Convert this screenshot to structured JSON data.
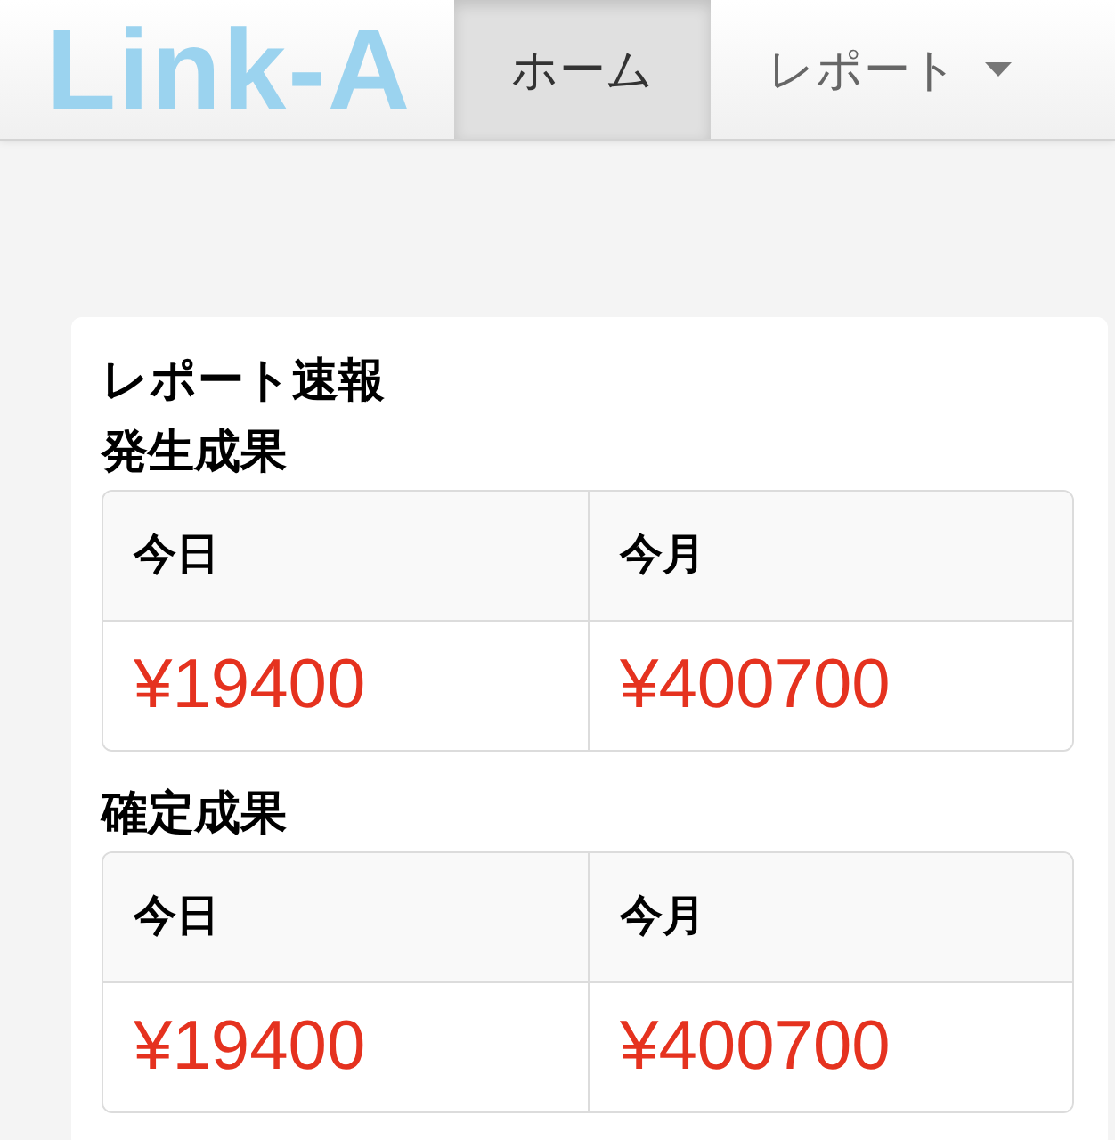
{
  "navbar": {
    "logo": "Link-A",
    "items": [
      {
        "label": "ホーム",
        "kind": "link",
        "selected": true
      },
      {
        "label": "レポート",
        "kind": "dropdown",
        "selected": false
      }
    ]
  },
  "card": {
    "title": "レポート速報",
    "sections": [
      {
        "heading": "発生成果",
        "columns": [
          "今日",
          "今月"
        ],
        "values": [
          "¥19400",
          "¥400700"
        ]
      },
      {
        "heading": "確定成果",
        "columns": [
          "今日",
          "今月"
        ],
        "values": [
          "¥19400",
          "¥400700"
        ]
      }
    ]
  }
}
